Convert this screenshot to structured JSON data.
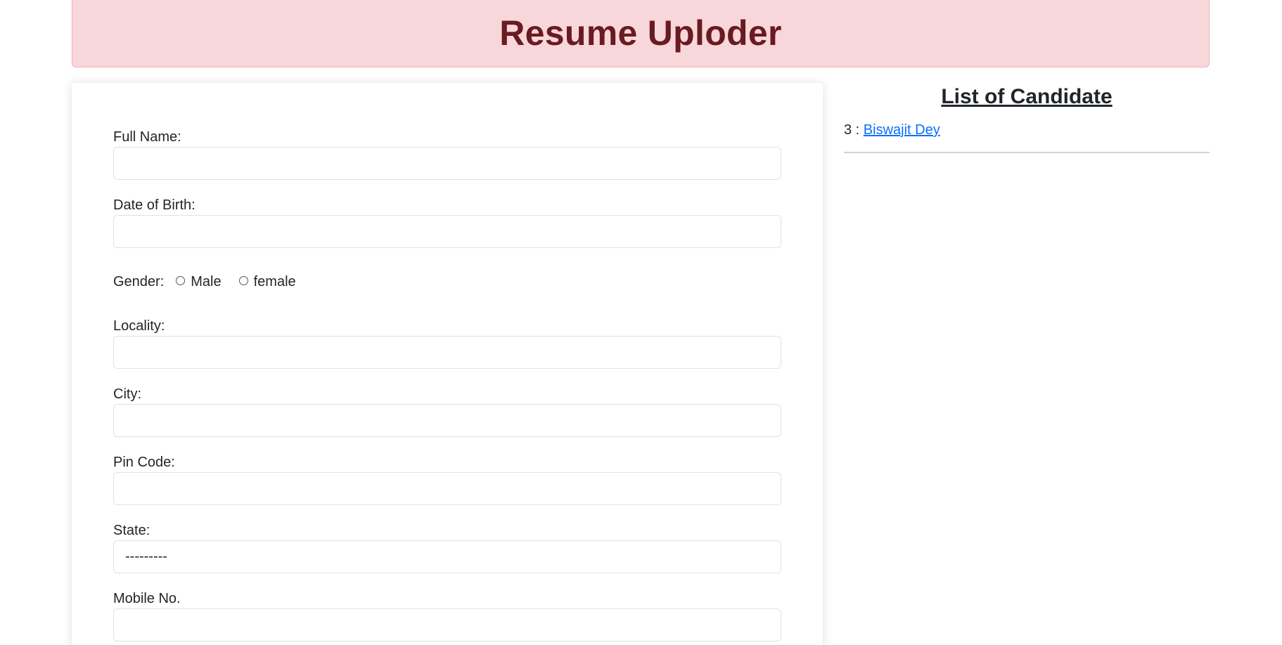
{
  "header": {
    "title": "Resume Uploder"
  },
  "form": {
    "full_name_label": "Full Name:",
    "full_name_value": "",
    "dob_label": "Date of Birth:",
    "dob_value": "",
    "gender_label": "Gender:",
    "gender_options": [
      "Male",
      "female"
    ],
    "locality_label": "Locality:",
    "locality_value": "",
    "city_label": "City:",
    "city_value": "",
    "pin_label": "Pin Code:",
    "pin_value": "",
    "state_label": "State:",
    "state_selected": "---------",
    "mobile_label": "Mobile No.",
    "mobile_value": ""
  },
  "candidates": {
    "title": "List of Candidate",
    "items": [
      {
        "id": "3",
        "separator": " : ",
        "name": "Biswajit Dey"
      }
    ]
  }
}
